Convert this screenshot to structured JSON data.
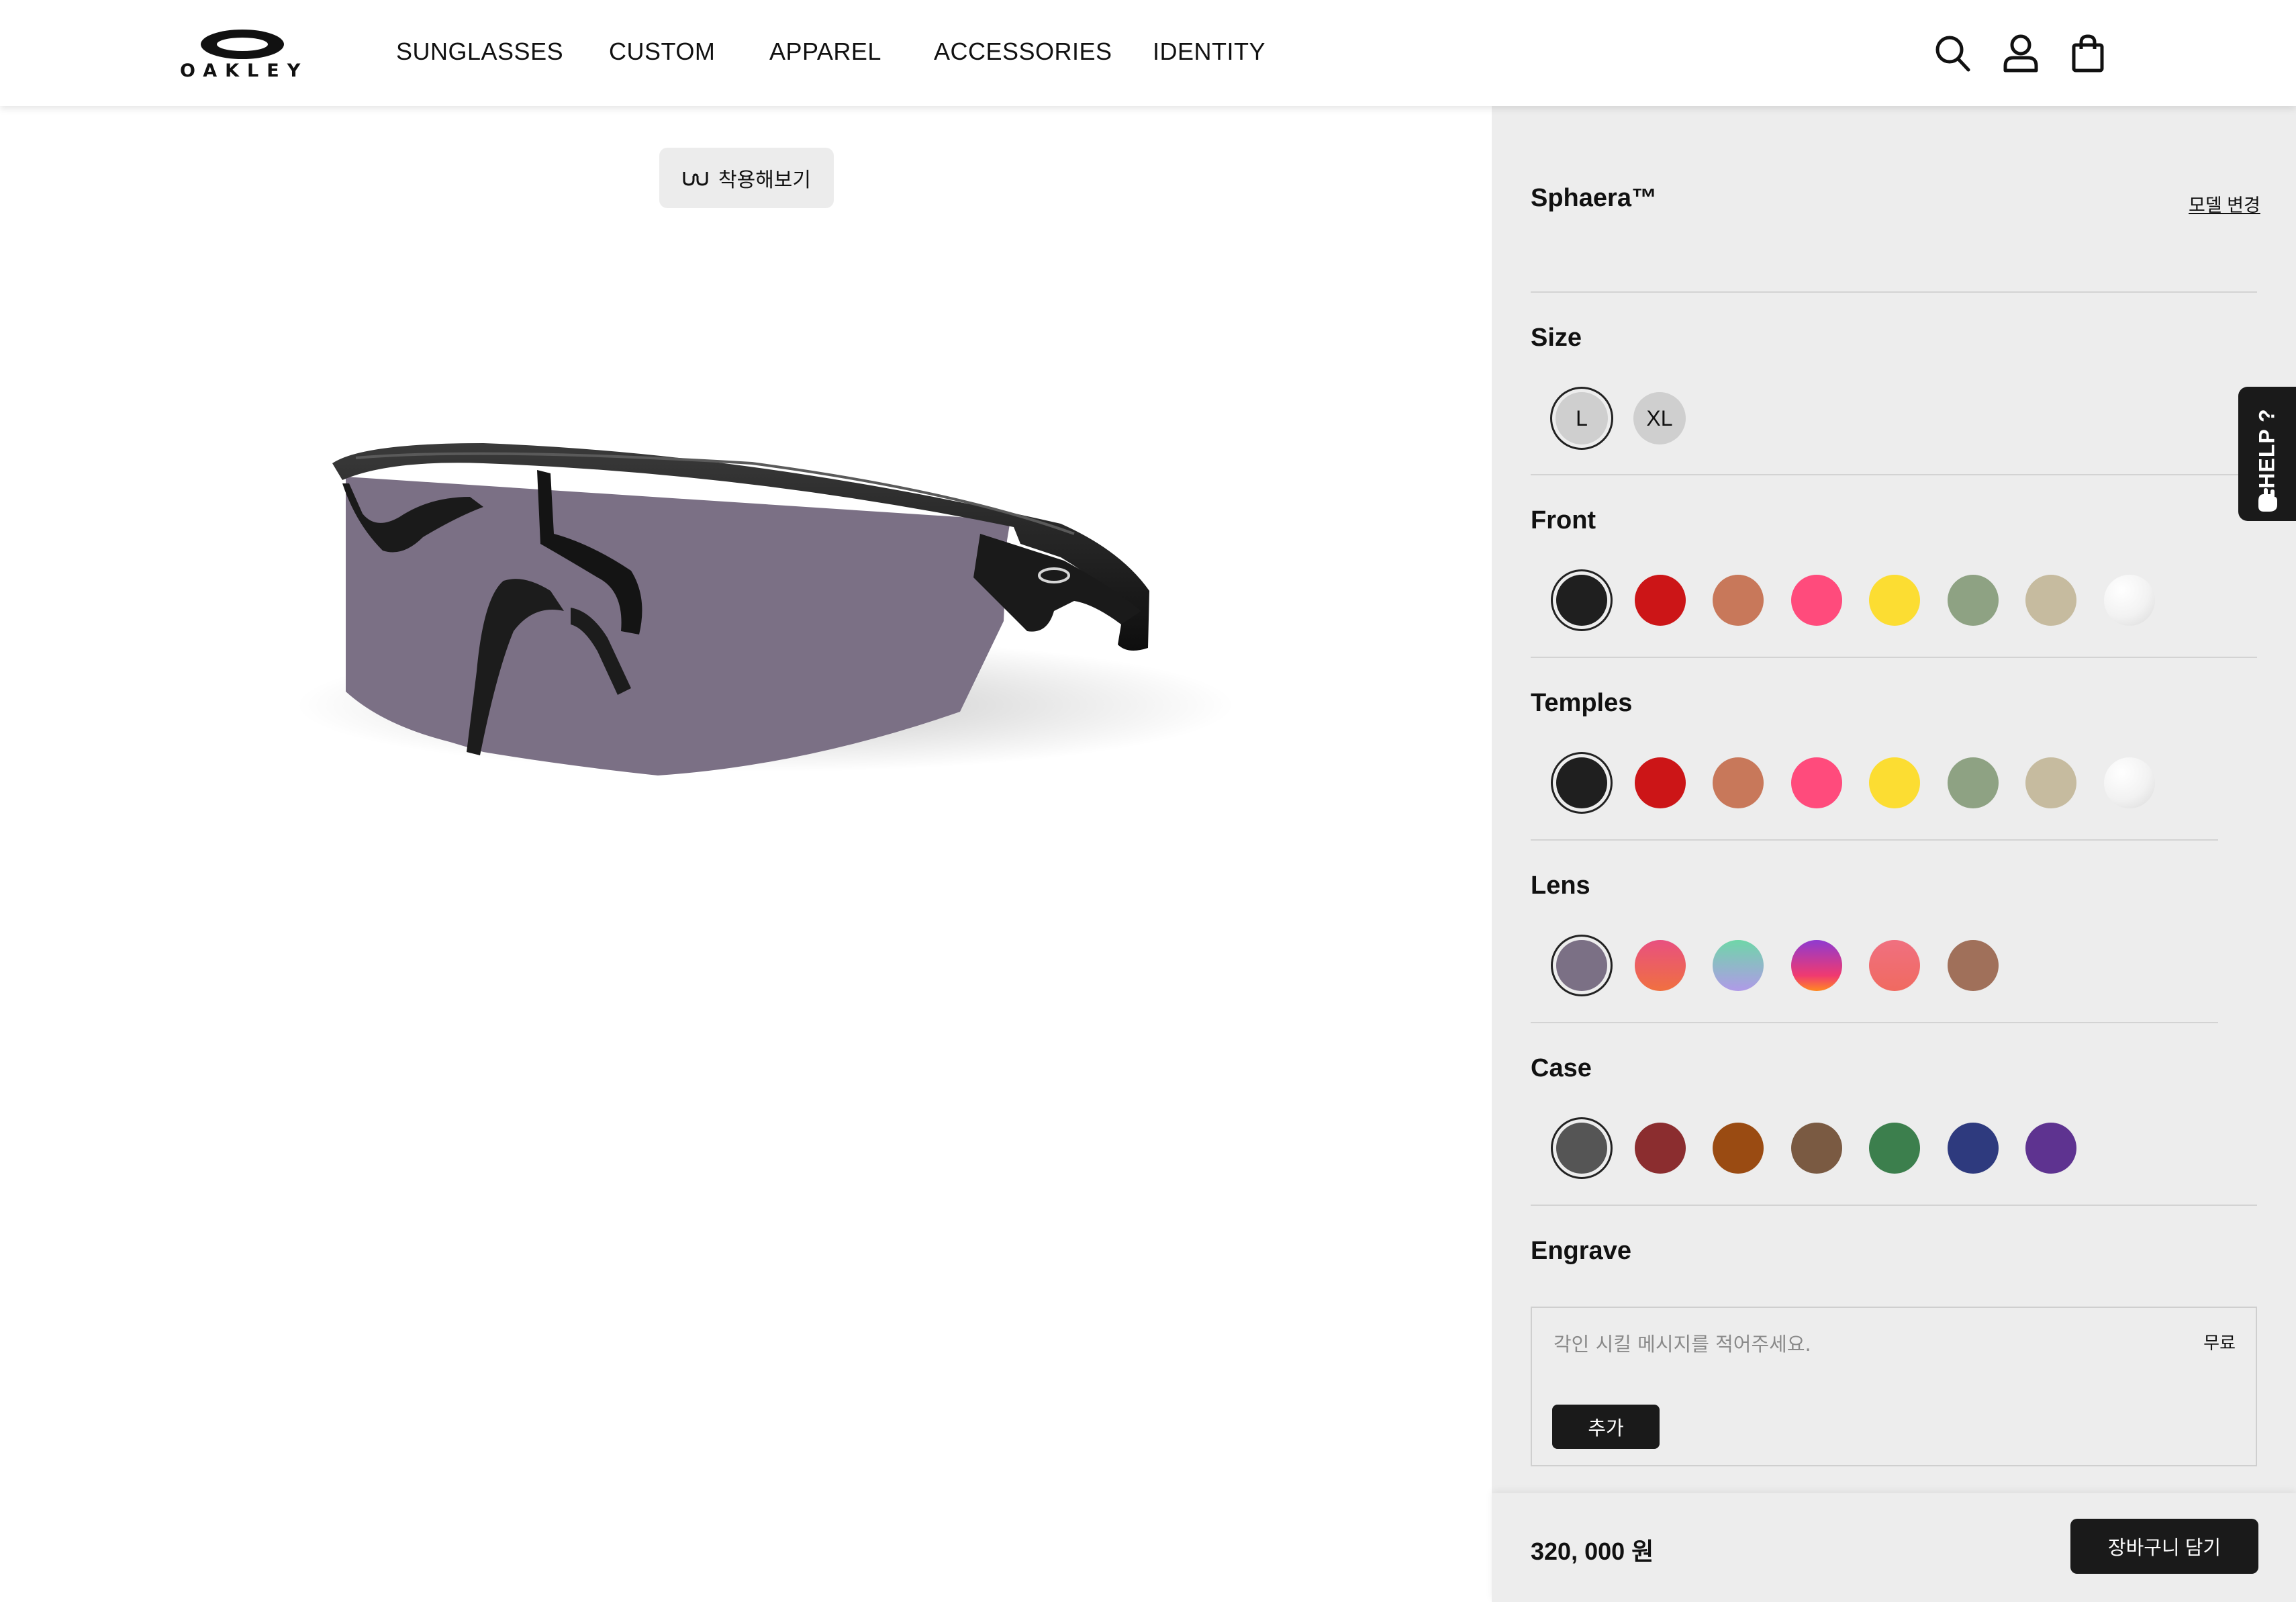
{
  "brand": {
    "logo_text": "OAKLEY"
  },
  "nav": {
    "items": [
      {
        "label": "SUNGLASSES"
      },
      {
        "label": "CUSTOM"
      },
      {
        "label": "APPAREL"
      },
      {
        "label": "ACCESSORIES"
      },
      {
        "label": "IDENTITY"
      }
    ]
  },
  "header_icons": [
    "search-icon",
    "account-icon",
    "bag-icon"
  ],
  "tryon": {
    "label": "착용해보기",
    "icon": "glasses-icon"
  },
  "product": {
    "image": "sphaera-sunglasses",
    "lens_color": "#7b7085",
    "frame_color": "#1f1f1f"
  },
  "config": {
    "model_name": "Sphaera™",
    "change_model_label": "모델 변경",
    "size": {
      "title": "Size",
      "options": [
        "L",
        "XL"
      ],
      "selected": "L"
    },
    "front": {
      "title": "Front",
      "colors": [
        "#1f1f1f",
        "#cc1517",
        "#c8785a",
        "#ff4b7c",
        "#fcdd32",
        "#8ea283",
        "#c6bb9f",
        "#f4f4f4"
      ],
      "selected_index": 0
    },
    "temples": {
      "title": "Temples",
      "colors": [
        "#1f1f1f",
        "#cc1517",
        "#c8785a",
        "#ff4b7c",
        "#fcdd32",
        "#8ea283",
        "#c6bb9f",
        "#f4f4f4"
      ],
      "selected_index": 0
    },
    "lens": {
      "title": "Lens",
      "colors": [
        "#7b7085",
        "#e84c6f",
        "#79d2b6",
        "#a43ec0",
        "#f07070",
        "#a0705a"
      ],
      "selected_index": 0
    },
    "case": {
      "title": "Case",
      "colors": [
        "#555555",
        "#8b2d2f",
        "#9a4b12",
        "#7a5a42",
        "#3c7f4d",
        "#2e3a7e",
        "#5e3390"
      ],
      "selected_index": 0
    },
    "engrave": {
      "title": "Engrave",
      "placeholder": "각인 시킬 메시지를 적어주세요.",
      "price_label": "무료",
      "add_label": "추가"
    }
  },
  "footer": {
    "price": "320, 000 원",
    "cart_label": "장바구니 담기"
  },
  "help": {
    "label": "HELP ?"
  }
}
